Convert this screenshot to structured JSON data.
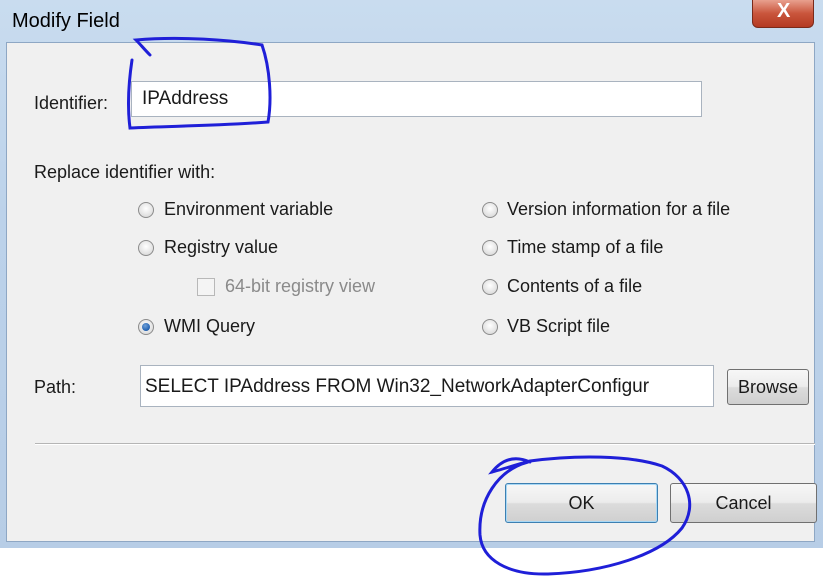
{
  "window": {
    "title": "Modify Field",
    "close_glyph": "X"
  },
  "identifier": {
    "label": "Identifier:",
    "value": "IPAddress"
  },
  "replace": {
    "label": "Replace identifier with:",
    "options": [
      {
        "label": "Environment variable",
        "checked": false
      },
      {
        "label": "Registry value",
        "checked": false
      },
      {
        "label": "WMI Query",
        "checked": true
      },
      {
        "label": "Version information for a file",
        "checked": false
      },
      {
        "label": "Time stamp of a file",
        "checked": false
      },
      {
        "label": "Contents of a file",
        "checked": false
      },
      {
        "label": "VB Script file",
        "checked": false
      }
    ],
    "registry_view": {
      "label": "64-bit registry view",
      "checked": false,
      "enabled": false
    }
  },
  "path": {
    "label": "Path:",
    "value": "SELECT IPAddress FROM Win32_NetworkAdapterConfigur",
    "browse_label": "Browse"
  },
  "buttons": {
    "ok_label": "OK",
    "cancel_label": "Cancel"
  },
  "colors": {
    "annotation_ink": "#1f1fd8",
    "title_bar": "#bcd2ea",
    "close_button": "#c9553c",
    "dialog_face": "#f0f0f0"
  }
}
